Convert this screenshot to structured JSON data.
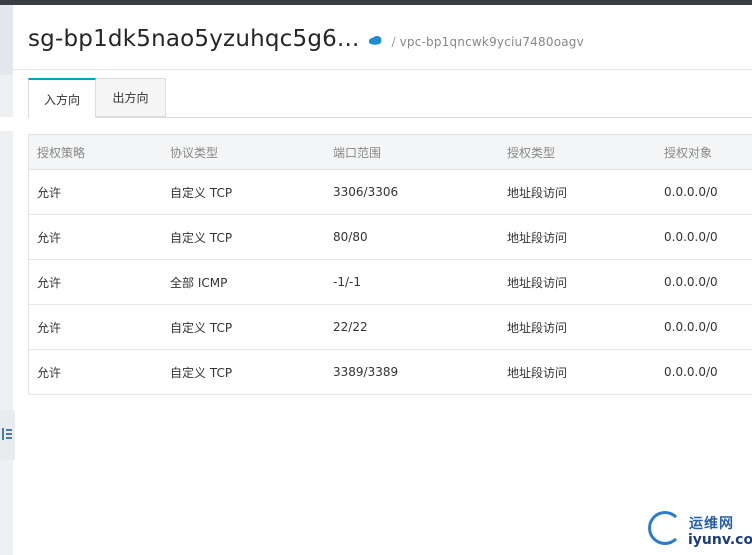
{
  "header": {
    "sg_title": "sg-bp1dk5nao5yzuhqc5g6...",
    "separator": "/",
    "vpc_id": "vpc-bp1qncwk9yciu7480oagv"
  },
  "tabs": [
    {
      "label": "入方向",
      "active": true
    },
    {
      "label": "出方向",
      "active": false
    }
  ],
  "table": {
    "columns": [
      "授权策略",
      "协议类型",
      "端口范围",
      "授权类型",
      "授权对象"
    ],
    "rows": [
      [
        "允许",
        "自定义 TCP",
        "3306/3306",
        "地址段访问",
        "0.0.0.0/0"
      ],
      [
        "允许",
        "自定义 TCP",
        "80/80",
        "地址段访问",
        "0.0.0.0/0"
      ],
      [
        "允许",
        "全部 ICMP",
        "-1/-1",
        "地址段访问",
        "0.0.0.0/0"
      ],
      [
        "允许",
        "自定义 TCP",
        "22/22",
        "地址段访问",
        "0.0.0.0/0"
      ],
      [
        "允许",
        "自定义 TCP",
        "3389/3389",
        "地址段访问",
        "0.0.0.0/0"
      ]
    ]
  },
  "watermark": {
    "top": "运维网",
    "bottom": "iyunv.com"
  },
  "colors": {
    "accent": "#00a2ca",
    "topbar": "#373d41"
  },
  "icons": {
    "cloud": "cloud-icon",
    "sidebar_toggle": "list-icon",
    "logo": "iyunv-logo-icon"
  }
}
